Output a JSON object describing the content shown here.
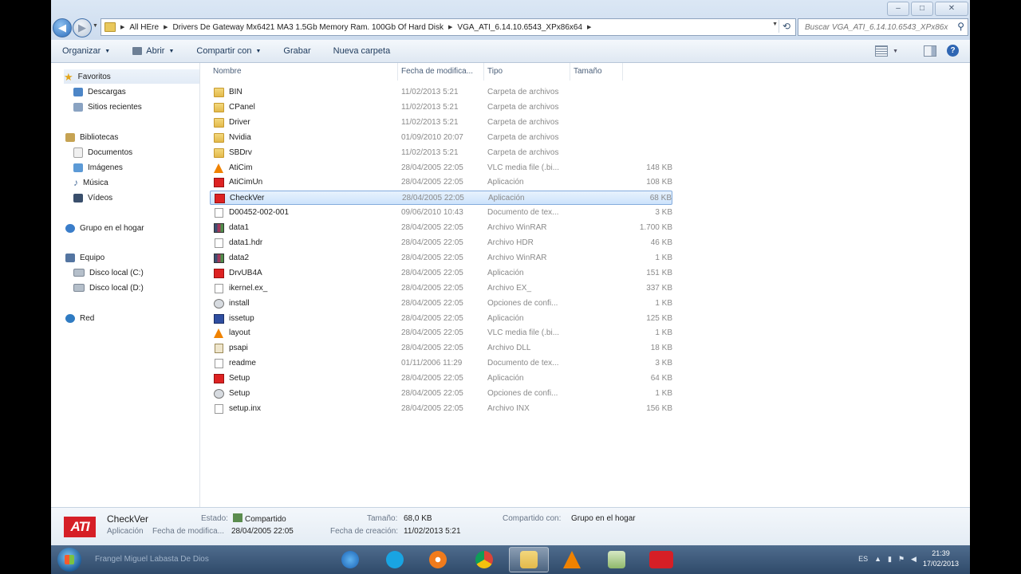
{
  "address": {
    "crumbs": [
      "All HEre",
      "Drivers De Gateway Mx6421 MA3 1.5Gb Memory Ram. 100Gb Of Hard Disk",
      "VGA_ATI_6.14.10.6543_XPx86x64"
    ],
    "search_placeholder": "Buscar VGA_ATI_6.14.10.6543_XPx86x64"
  },
  "toolbar": {
    "organize": "Organizar",
    "open": "Abrir",
    "share": "Compartir con",
    "burn": "Grabar",
    "new_folder": "Nueva carpeta"
  },
  "nav": {
    "favorites": "Favoritos",
    "downloads": "Descargas",
    "recent": "Sitios recientes",
    "libraries": "Bibliotecas",
    "documents": "Documentos",
    "images": "Imágenes",
    "music": "Música",
    "videos": "Vídeos",
    "homegroup": "Grupo en el hogar",
    "computer": "Equipo",
    "drive_c": "Disco local (C:)",
    "drive_d": "Disco local (D:)",
    "network": "Red"
  },
  "columns": {
    "name": "Nombre",
    "date": "Fecha de modifica...",
    "type": "Tipo",
    "size": "Tamaño"
  },
  "files": [
    {
      "name": "BIN",
      "date": "11/02/2013 5:21",
      "type": "Carpeta de archivos",
      "size": "",
      "icon": "folder"
    },
    {
      "name": "CPanel",
      "date": "11/02/2013 5:21",
      "type": "Carpeta de archivos",
      "size": "",
      "icon": "folder"
    },
    {
      "name": "Driver",
      "date": "11/02/2013 5:21",
      "type": "Carpeta de archivos",
      "size": "",
      "icon": "folder"
    },
    {
      "name": "Nvidia",
      "date": "01/09/2010 20:07",
      "type": "Carpeta de archivos",
      "size": "",
      "icon": "folder"
    },
    {
      "name": "SBDrv",
      "date": "11/02/2013 5:21",
      "type": "Carpeta de archivos",
      "size": "",
      "icon": "folder"
    },
    {
      "name": "AtiCim",
      "date": "28/04/2005 22:05",
      "type": "VLC media file (.bi...",
      "size": "148 KB",
      "icon": "vlc"
    },
    {
      "name": "AtiCimUn",
      "date": "28/04/2005 22:05",
      "type": "Aplicación",
      "size": "108 KB",
      "icon": "ati"
    },
    {
      "name": "CheckVer",
      "date": "28/04/2005 22:05",
      "type": "Aplicación",
      "size": "68 KB",
      "icon": "ati"
    },
    {
      "name": "D00452-002-001",
      "date": "09/06/2010 10:43",
      "type": "Documento de tex...",
      "size": "3 KB",
      "icon": "doc"
    },
    {
      "name": "data1",
      "date": "28/04/2005 22:05",
      "type": "Archivo WinRAR",
      "size": "1.700 KB",
      "icon": "rar"
    },
    {
      "name": "data1.hdr",
      "date": "28/04/2005 22:05",
      "type": "Archivo HDR",
      "size": "46 KB",
      "icon": "doc"
    },
    {
      "name": "data2",
      "date": "28/04/2005 22:05",
      "type": "Archivo WinRAR",
      "size": "1 KB",
      "icon": "rar"
    },
    {
      "name": "DrvUB4A",
      "date": "28/04/2005 22:05",
      "type": "Aplicación",
      "size": "151 KB",
      "icon": "ati"
    },
    {
      "name": "ikernel.ex_",
      "date": "28/04/2005 22:05",
      "type": "Archivo EX_",
      "size": "337 KB",
      "icon": "doc"
    },
    {
      "name": "install",
      "date": "28/04/2005 22:05",
      "type": "Opciones de confi...",
      "size": "1 KB",
      "icon": "gear"
    },
    {
      "name": "issetup",
      "date": "28/04/2005 22:05",
      "type": "Aplicación",
      "size": "125 KB",
      "icon": "setup"
    },
    {
      "name": "layout",
      "date": "28/04/2005 22:05",
      "type": "VLC media file (.bi...",
      "size": "1 KB",
      "icon": "vlc"
    },
    {
      "name": "psapi",
      "date": "28/04/2005 22:05",
      "type": "Archivo DLL",
      "size": "18 KB",
      "icon": "dll"
    },
    {
      "name": "readme",
      "date": "01/11/2006 11:29",
      "type": "Documento de tex...",
      "size": "3 KB",
      "icon": "doc"
    },
    {
      "name": "Setup",
      "date": "28/04/2005 22:05",
      "type": "Aplicación",
      "size": "64 KB",
      "icon": "ati"
    },
    {
      "name": "Setup",
      "date": "28/04/2005 22:05",
      "type": "Opciones de confi...",
      "size": "1 KB",
      "icon": "gear"
    },
    {
      "name": "setup.inx",
      "date": "28/04/2005 22:05",
      "type": "Archivo INX",
      "size": "156 KB",
      "icon": "doc"
    }
  ],
  "selected_index": 7,
  "details": {
    "thumb": "ATI",
    "name": "CheckVer",
    "kind": "Aplicación",
    "modified_label": "Fecha de modifica...",
    "modified": "28/04/2005 22:05",
    "state_label": "Estado:",
    "state": "Compartido",
    "size_label": "Tamaño:",
    "size": "68,0 KB",
    "created_label": "Fecha de creación:",
    "created": "11/02/2013 5:21",
    "shared_label": "Compartido con:",
    "shared": "Grupo en el hogar"
  },
  "taskbar": {
    "user": "Frangel Miguel Labasta De Dios",
    "lang": "ES",
    "time": "21:39",
    "date": "17/02/2013"
  },
  "colors": {
    "selection": "#cde3fb",
    "ati_red": "#d61f26",
    "taskbar": "#3b5678"
  }
}
